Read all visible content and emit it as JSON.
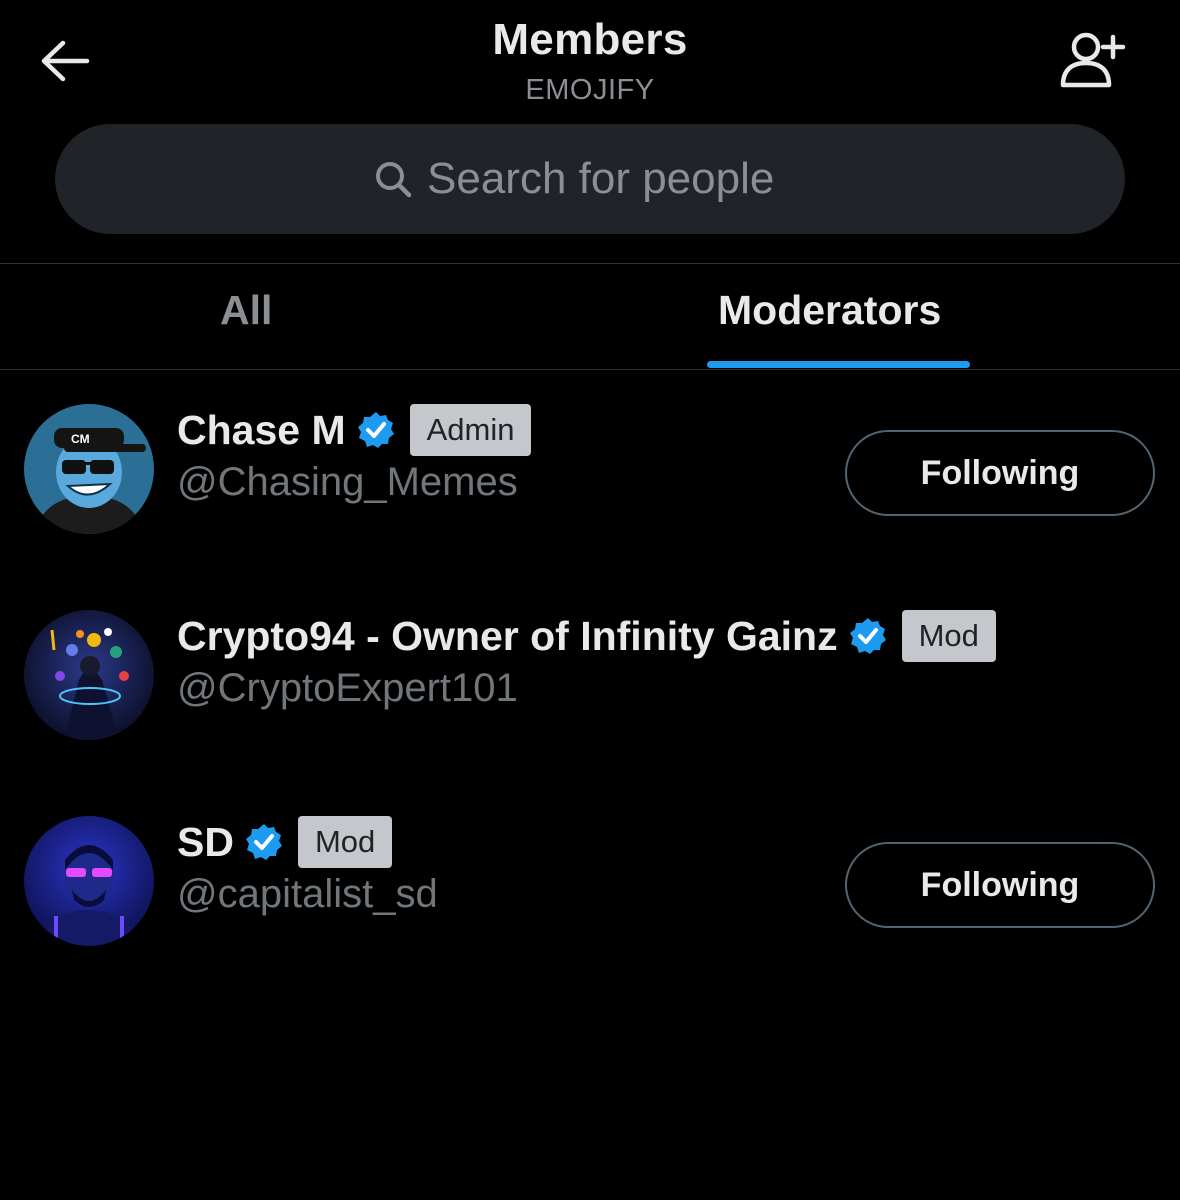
{
  "header": {
    "title": "Members",
    "subtitle": "EMOJIFY"
  },
  "search": {
    "placeholder": "Search for people"
  },
  "tabs": [
    {
      "label": "All",
      "active": false
    },
    {
      "label": "Moderators",
      "active": true
    }
  ],
  "colors": {
    "background": "#000000",
    "accent": "#1d9bf0",
    "search_bg": "#202327",
    "badge_bg": "#c4c7cb",
    "muted_text": "#71767b"
  },
  "members": [
    {
      "name": "Chase M",
      "verified": true,
      "role": "Admin",
      "handle": "@Chasing_Memes",
      "follow_label": "Following",
      "avatar_text": "CM"
    },
    {
      "name": "Crypto94 - Owner of Infinity Gainz",
      "verified": true,
      "role": "Mod",
      "handle": "@CryptoExpert101",
      "follow_label": null
    },
    {
      "name": "SD",
      "verified": true,
      "role": "Mod",
      "handle": "@capitalist_sd",
      "follow_label": "Following"
    }
  ],
  "icons": {
    "back": "arrow-left-icon",
    "add_member": "add-person-icon",
    "search": "search-icon",
    "verified": "verified-badge-icon"
  }
}
